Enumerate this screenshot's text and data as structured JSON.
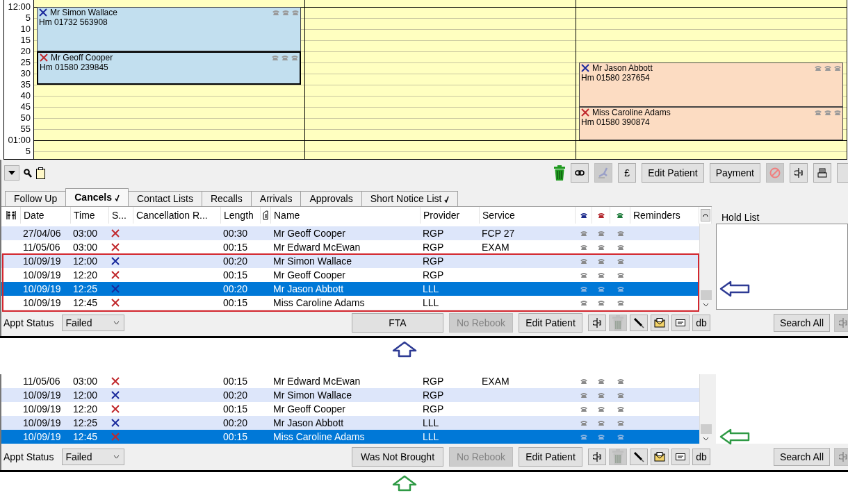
{
  "calendar": {
    "time_labels": [
      "12:00",
      "5",
      "10",
      "15",
      "20",
      "25",
      "30",
      "35",
      "40",
      "45",
      "50",
      "55",
      "01:00",
      "5"
    ],
    "columns": [
      {
        "cells": [
          {
            "kind": "start",
            "name": "Mr Simon Wallace",
            "phone": "Hm 01732 563908",
            "color": "#c2dfef",
            "status_icon": {
              "color": "#1a2a9c"
            },
            "selected": false
          },
          {
            "kind": "cont"
          },
          {
            "kind": "cont"
          },
          {
            "kind": "cont"
          },
          {
            "kind": "start",
            "name": "Mr Geoff Cooper",
            "phone": "Hm 01580 239845",
            "color": "#c2dfef",
            "status_icon": {
              "color": "#c0282c"
            },
            "selected": true
          },
          {
            "kind": "cont"
          },
          {
            "kind": "cont"
          },
          {
            "kind": "free"
          },
          {
            "kind": "free"
          },
          {
            "kind": "free"
          },
          {
            "kind": "free"
          },
          {
            "kind": "free"
          },
          {
            "kind": "free"
          },
          {
            "kind": "free"
          }
        ]
      },
      {
        "cells": [
          {
            "kind": "free"
          },
          {
            "kind": "free"
          },
          {
            "kind": "free"
          },
          {
            "kind": "free"
          },
          {
            "kind": "free"
          },
          {
            "kind": "free"
          },
          {
            "kind": "free"
          },
          {
            "kind": "free"
          },
          {
            "kind": "free"
          },
          {
            "kind": "free"
          },
          {
            "kind": "free"
          },
          {
            "kind": "free"
          },
          {
            "kind": "free"
          },
          {
            "kind": "free"
          }
        ]
      },
      {
        "cells": [
          {
            "kind": "free"
          },
          {
            "kind": "free"
          },
          {
            "kind": "free"
          },
          {
            "kind": "free"
          },
          {
            "kind": "free"
          },
          {
            "kind": "start",
            "name": "Mr Jason Abbott",
            "phone": "Hm 01580 237654",
            "color": "#fcdcc2",
            "status_icon": {
              "color": "#1a2a9c"
            },
            "selected": false
          },
          {
            "kind": "cont"
          },
          {
            "kind": "cont"
          },
          {
            "kind": "cont"
          },
          {
            "kind": "start",
            "name": "Miss Caroline Adams",
            "phone": "Hm 01580 390874",
            "color": "#fcdcc2",
            "status_icon": {
              "color": "#c0282c"
            },
            "selected": false
          },
          {
            "kind": "cont"
          },
          {
            "kind": "cont"
          },
          {
            "kind": "free"
          },
          {
            "kind": "free"
          }
        ]
      }
    ]
  },
  "toolbar": {
    "left": [
      {
        "kind": "dropdown"
      },
      {
        "kind": "search"
      },
      {
        "kind": "clipboard"
      }
    ],
    "right": [
      {
        "kind": "trash"
      },
      {
        "kind": "link",
        "disabled": false
      },
      {
        "kind": "chair",
        "disabled": true
      },
      {
        "kind": "text",
        "label": "£",
        "disabled": false
      },
      {
        "kind": "text",
        "label": "Edit Patient",
        "disabled": false
      },
      {
        "kind": "text",
        "label": "Payment",
        "disabled": false
      },
      {
        "kind": "no_entry",
        "disabled": true
      },
      {
        "kind": "split",
        "disabled": false
      },
      {
        "kind": "printer",
        "disabled": false
      },
      {
        "kind": "blank",
        "disabled": false
      }
    ]
  },
  "tabs": [
    {
      "label": "Follow Up",
      "selected": false,
      "ticked": false
    },
    {
      "label": "Cancels",
      "selected": true,
      "ticked": true
    },
    {
      "label": "Contact Lists",
      "selected": false,
      "ticked": false
    },
    {
      "label": "Recalls",
      "selected": false,
      "ticked": false
    },
    {
      "label": "Arrivals",
      "selected": false,
      "ticked": false
    },
    {
      "label": "Approvals",
      "selected": false,
      "ticked": false
    },
    {
      "label": "Short Notice List",
      "selected": false,
      "ticked": true
    }
  ],
  "columns": [
    {
      "kind": "people"
    },
    {
      "kind": "text",
      "label": "Date"
    },
    {
      "kind": "text",
      "label": "Time"
    },
    {
      "kind": "text",
      "label": "S..."
    },
    {
      "kind": "text",
      "label": "Cancellation R..."
    },
    {
      "kind": "text",
      "label": "Length"
    },
    {
      "kind": "note"
    },
    {
      "kind": "text",
      "label": "Name"
    },
    {
      "kind": "text",
      "label": "Provider"
    },
    {
      "kind": "text",
      "label": "Service"
    },
    {
      "kind": "phone",
      "color": "#1e2c8c"
    },
    {
      "kind": "phone",
      "color": "#b3262c"
    },
    {
      "kind": "phone",
      "color": "#1d7a3a"
    },
    {
      "kind": "text",
      "label": "Reminders"
    },
    {
      "kind": "refresh"
    }
  ],
  "hold_list_title": "Hold List",
  "panels": [
    {
      "rows": [
        {
          "date": "27/04/06",
          "time": "03:00",
          "status_icon": {
            "color": "#c0282c"
          },
          "length": "00:30",
          "name": "Mr Geoff Cooper",
          "provider": "RGP",
          "service": "FCP 27",
          "shaded": true,
          "selected": false,
          "highlighted": false
        },
        {
          "date": "11/05/06",
          "time": "03:00",
          "status_icon": {
            "color": "#c0282c"
          },
          "length": "00:15",
          "name": "Mr Edward McEwan",
          "provider": "RGP",
          "service": "EXAM",
          "shaded": false,
          "selected": false,
          "highlighted": false
        },
        {
          "date": "10/09/19",
          "time": "12:00",
          "status_icon": {
            "color": "#1a2a9c"
          },
          "length": "00:20",
          "name": "Mr Simon Wallace",
          "provider": "RGP",
          "shaded": true,
          "selected": false,
          "highlighted": true
        },
        {
          "date": "10/09/19",
          "time": "12:20",
          "status_icon": {
            "color": "#c0282c"
          },
          "length": "00:15",
          "name": "Mr Geoff Cooper",
          "provider": "RGP",
          "shaded": false,
          "selected": false,
          "highlighted": true
        },
        {
          "date": "10/09/19",
          "time": "12:25",
          "status_icon": {
            "color": "#1a2a9c"
          },
          "length": "00:20",
          "name": "Mr Jason Abbott",
          "provider": "LLL",
          "shaded": true,
          "selected": true,
          "highlighted": true
        },
        {
          "date": "10/09/19",
          "time": "12:45",
          "status_icon": {
            "color": "#c0282c"
          },
          "length": "00:15",
          "name": "Miss Caroline Adams",
          "provider": "LLL",
          "shaded": false,
          "selected": false,
          "highlighted": true
        }
      ],
      "hold_framed": true,
      "status_label": "Appt Status",
      "status_value": "Failed",
      "buttons": [
        {
          "label": "FTA",
          "disabled": false
        },
        {
          "label": "No Rebook",
          "disabled": true
        },
        {
          "label": "Edit Patient",
          "disabled": false
        }
      ],
      "icon_buttons": [
        {
          "kind": "split",
          "disabled": false
        },
        {
          "kind": "trash",
          "disabled": true
        },
        {
          "kind": "pen",
          "disabled": false
        },
        {
          "kind": "letter",
          "disabled": false
        },
        {
          "kind": "card",
          "disabled": false
        },
        {
          "kind": "text",
          "label": "db",
          "disabled": false
        }
      ],
      "search_button": "Search All",
      "arrow": {
        "color": "#2e3b94"
      }
    },
    {
      "rows": [
        {
          "date": "11/05/06",
          "time": "03:00",
          "status_icon": {
            "color": "#c0282c"
          },
          "length": "00:15",
          "name": "Mr Edward McEwan",
          "provider": "RGP",
          "service": "EXAM",
          "shaded": false,
          "selected": false,
          "highlighted": false
        },
        {
          "date": "10/09/19",
          "time": "12:00",
          "status_icon": {
            "color": "#1a2a9c"
          },
          "length": "00:20",
          "name": "Mr Simon Wallace",
          "provider": "RGP",
          "shaded": true,
          "selected": false,
          "highlighted": false
        },
        {
          "date": "10/09/19",
          "time": "12:20",
          "status_icon": {
            "color": "#c0282c"
          },
          "length": "00:15",
          "name": "Mr Geoff Cooper",
          "provider": "RGP",
          "shaded": false,
          "selected": false,
          "highlighted": false
        },
        {
          "date": "10/09/19",
          "time": "12:25",
          "status_icon": {
            "color": "#1a2a9c"
          },
          "length": "00:20",
          "name": "Mr Jason Abbott",
          "provider": "LLL",
          "shaded": true,
          "selected": false,
          "highlighted": false
        },
        {
          "date": "10/09/19",
          "time": "12:45",
          "status_icon": {
            "color": "#c0282c"
          },
          "length": "00:15",
          "name": "Miss Caroline Adams",
          "provider": "LLL",
          "shaded": false,
          "selected": true,
          "highlighted": false
        }
      ],
      "hold_framed": false,
      "status_label": "Appt Status",
      "status_value": "Failed",
      "buttons": [
        {
          "label": "Was Not Brought",
          "disabled": false
        },
        {
          "label": "No Rebook",
          "disabled": true
        },
        {
          "label": "Edit Patient",
          "disabled": false
        }
      ],
      "icon_buttons": [
        {
          "kind": "split",
          "disabled": false
        },
        {
          "kind": "trash",
          "disabled": true
        },
        {
          "kind": "pen",
          "disabled": false
        },
        {
          "kind": "letter",
          "disabled": false
        },
        {
          "kind": "card",
          "disabled": false
        },
        {
          "kind": "text",
          "label": "db",
          "disabled": false
        }
      ],
      "search_button": "Search All",
      "arrow": {
        "color": "#2f9a45"
      }
    }
  ]
}
